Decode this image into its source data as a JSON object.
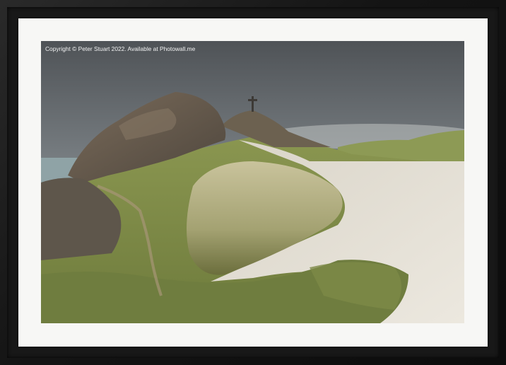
{
  "photo": {
    "copyright_text": "Copyright © Peter Stuart 2022. Available at Photowall.me",
    "subject": "cross-on-rocky-hill",
    "colors": {
      "sky_top": "#5c6064",
      "sky_bottom": "#aeb4b8",
      "grass": "#7a8a46",
      "dune_grass": "#b8b28a",
      "path": "#e6e1d8",
      "rock": "#6a5d4f",
      "sea": "#93a8ab"
    }
  },
  "frame": {
    "color": "#141414",
    "mount_color": "#f7f7f5"
  }
}
